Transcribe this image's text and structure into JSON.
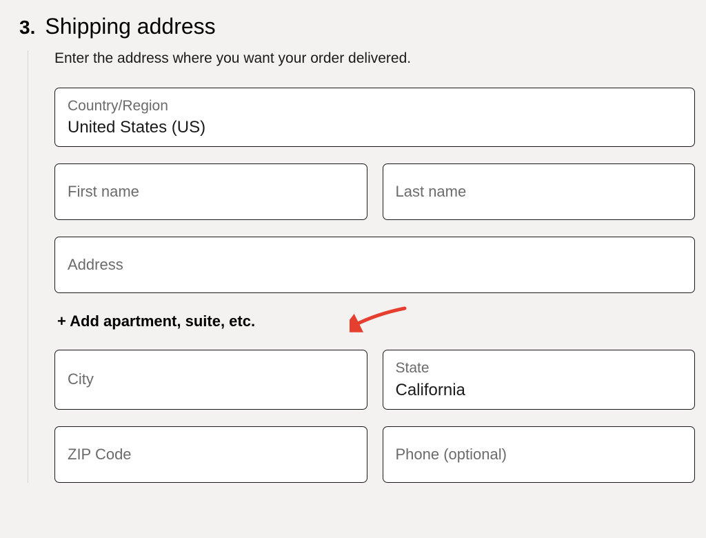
{
  "section": {
    "number": "3.",
    "title": "Shipping address",
    "subtitle": "Enter the address where you want your order delivered."
  },
  "fields": {
    "country": {
      "label": "Country/Region",
      "value": "United States (US)"
    },
    "first_name": {
      "label": "First name",
      "value": ""
    },
    "last_name": {
      "label": "Last name",
      "value": ""
    },
    "address": {
      "label": "Address",
      "value": ""
    },
    "add_apartment": {
      "label": "+ Add apartment, suite, etc."
    },
    "city": {
      "label": "City",
      "value": ""
    },
    "state": {
      "label": "State",
      "value": "California"
    },
    "zip": {
      "label": "ZIP Code",
      "value": ""
    },
    "phone": {
      "label": "Phone (optional)",
      "value": ""
    }
  },
  "annotation": {
    "arrow_color": "#e63e2f"
  }
}
